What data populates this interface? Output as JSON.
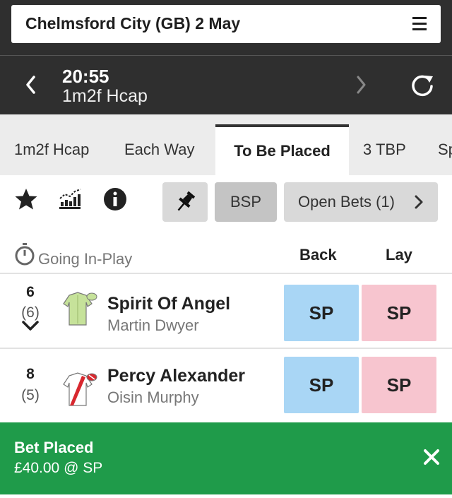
{
  "header": {
    "venue_title": "Chelmsford City (GB) 2 May"
  },
  "race": {
    "time": "20:55",
    "name": "1m2f Hcap"
  },
  "tabs": [
    {
      "label": "1m2f Hcap"
    },
    {
      "label": "Each Way"
    },
    {
      "label": "To Be Placed",
      "active": true
    },
    {
      "label": "3 TBP"
    },
    {
      "label": "Sp"
    }
  ],
  "toolbar": {
    "bsp_label": "BSP",
    "open_bets_label": "Open Bets (1)"
  },
  "columns": {
    "going_label": "Going In-Play",
    "back_label": "Back",
    "lay_label": "Lay"
  },
  "runners": [
    {
      "number": "6",
      "draw": "(6)",
      "name": "Spirit Of Angel",
      "jockey": "Martin Dwyer",
      "back": "SP",
      "lay": "SP",
      "silk_color": "#c6e29a"
    },
    {
      "number": "8",
      "draw": "(5)",
      "name": "Percy Alexander",
      "jockey": "Oisin Murphy",
      "back": "SP",
      "lay": "SP",
      "silk_color": "#ffffff"
    }
  ],
  "toast": {
    "title": "Bet Placed",
    "message": "£40.00 @ SP"
  },
  "colors": {
    "back": "#a9d6f5",
    "lay": "#f7c5cf",
    "success": "#1f9b4a",
    "header": "#2f2f2f"
  },
  "icons": [
    "menu-icon",
    "chevron-left-icon",
    "chevron-right-icon",
    "refresh-icon",
    "star-icon",
    "chart-icon",
    "info-icon",
    "pin-icon",
    "stopwatch-icon",
    "chevron-down-icon",
    "close-icon"
  ]
}
